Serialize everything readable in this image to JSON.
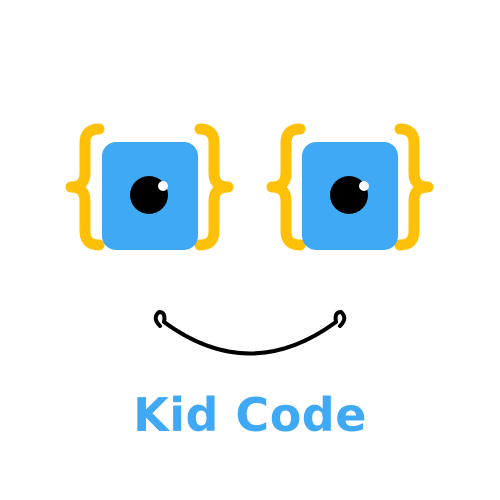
{
  "brand": {
    "name": "Kid Code"
  },
  "colors": {
    "background": "#ffffff",
    "brace": "#FFC107",
    "eye_square": "#3FA9F5",
    "pupil": "#000000",
    "highlight": "#ffffff",
    "smile": "#000000",
    "title": "#3FA9F5"
  },
  "icons": {
    "left_eye": "curly-brace-eye-icon",
    "right_eye": "curly-brace-eye-icon",
    "mouth": "smile-icon"
  }
}
